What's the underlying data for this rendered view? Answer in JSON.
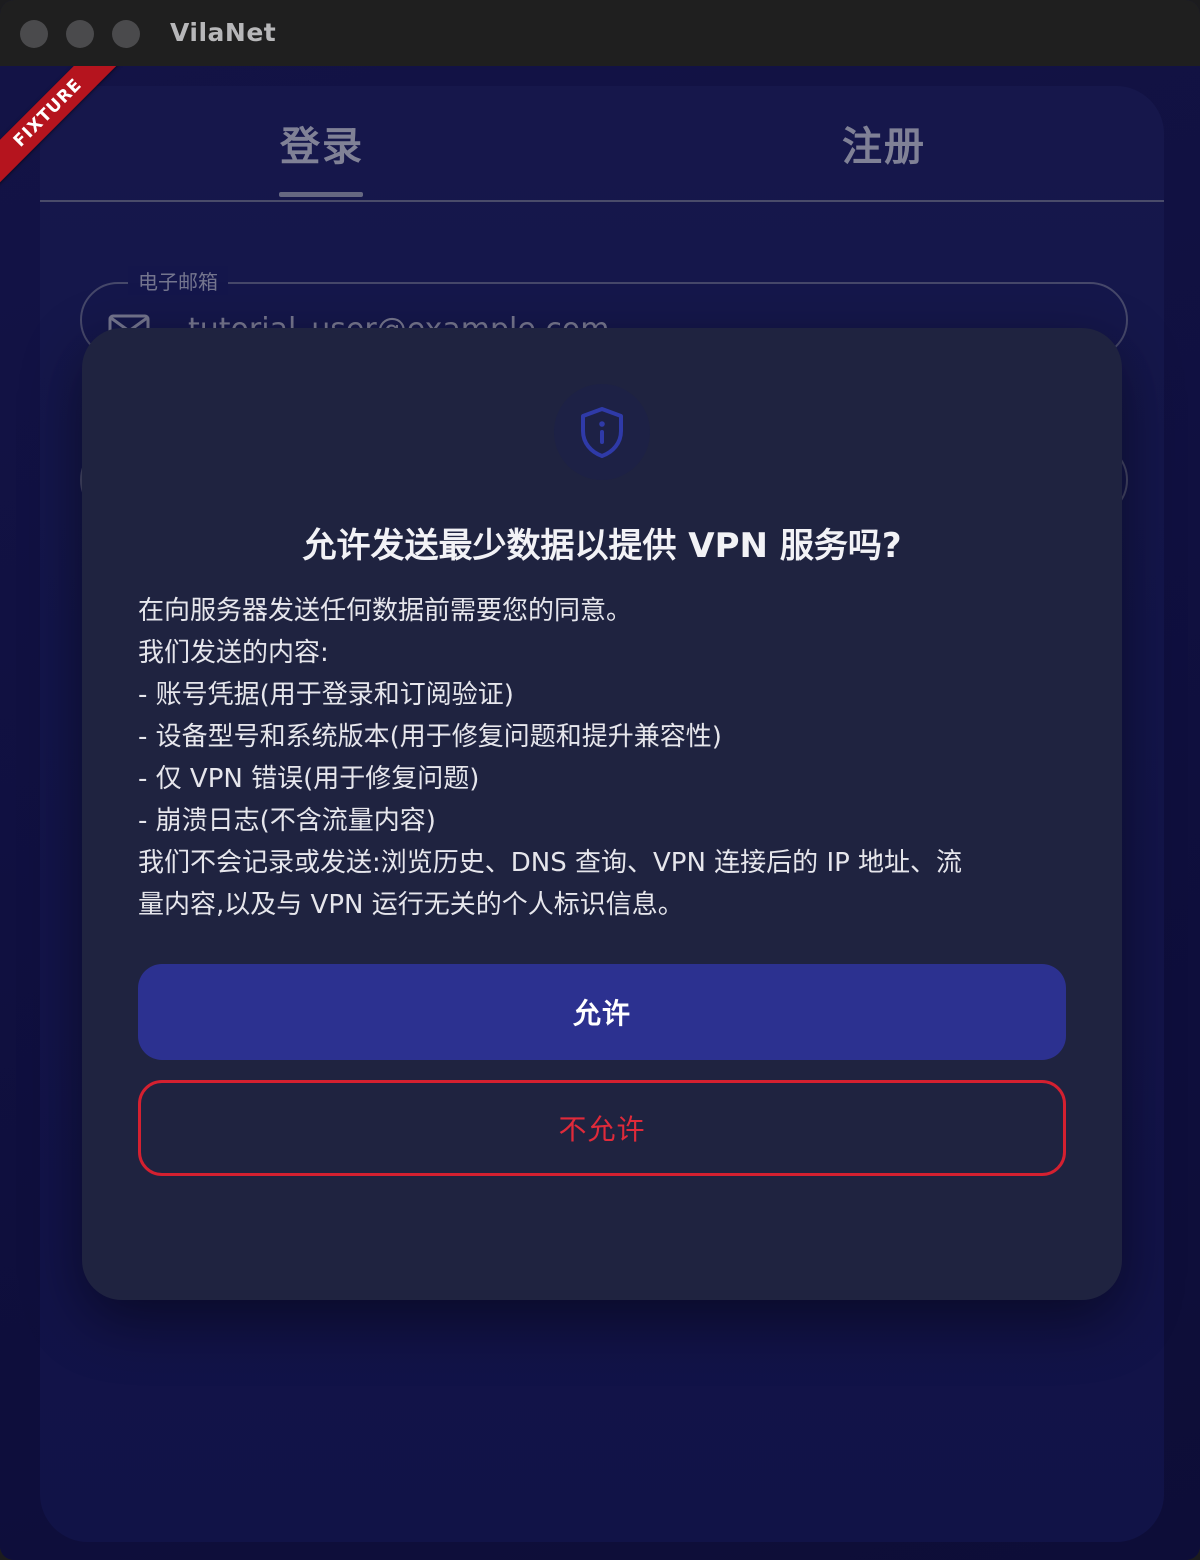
{
  "window": {
    "title": "VilaNet"
  },
  "badge": {
    "text": "FIXTURE"
  },
  "auth_tabs": {
    "login": "登录",
    "register": "注册",
    "selected": "登录"
  },
  "email_field": {
    "label": "电子邮箱",
    "value": "tutorial_user@example.com"
  },
  "consent_dialog": {
    "icon": "shield-info-icon",
    "title": "允许发送最少数据以提供 VPN 服务吗?",
    "body_lines": [
      "在向服务器发送任何数据前需要您的同意。",
      "我们发送的内容:",
      "- 账号凭据(用于登录和订阅验证)",
      "- 设备型号和系统版本(用于修复问题和提升兼容性)",
      "- 仅 VPN 错误(用于修复问题)",
      "- 崩溃日志(不含流量内容)",
      "我们不会记录或发送:浏览历史、DNS 查询、VPN 连接后的 IP 地址、流",
      "量内容,以及与 VPN 运行无关的个人标识信息。"
    ],
    "allow_label": "允许",
    "deny_label": "不允许"
  },
  "colors": {
    "background": "#131347",
    "dialog": "#1f2340",
    "primary_button": "#2c3190",
    "deny_accent": "#d42030",
    "badge": "#b5141e"
  }
}
